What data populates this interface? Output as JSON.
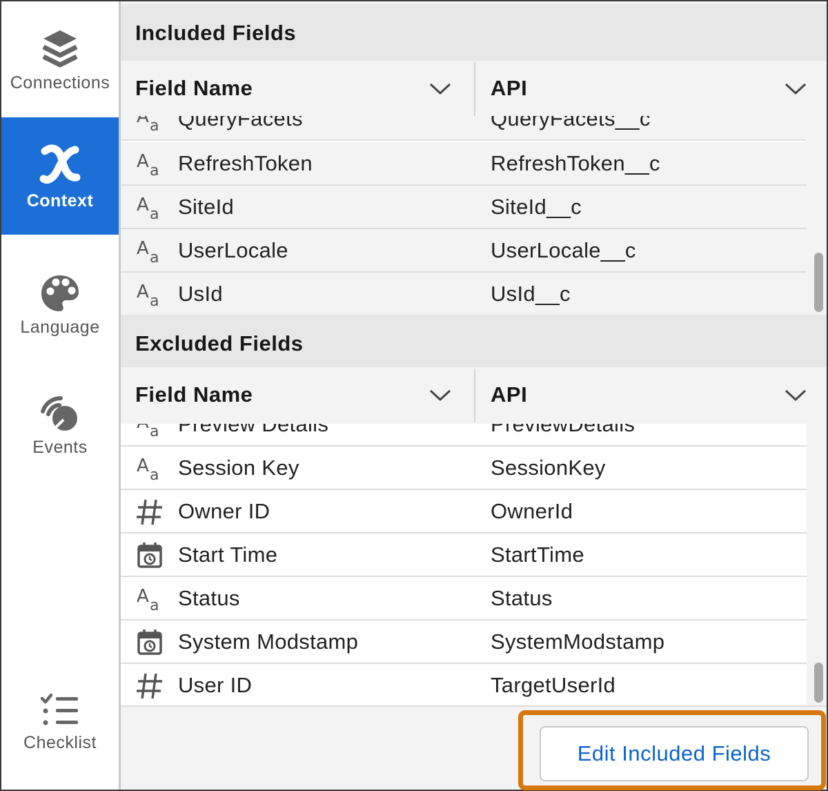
{
  "sidebar": {
    "items": [
      {
        "label": "Connections",
        "icon": "layers-icon",
        "active": false
      },
      {
        "label": "Context",
        "icon": "context-x-icon",
        "active": true
      },
      {
        "label": "Language",
        "icon": "palette-icon",
        "active": false
      },
      {
        "label": "Events",
        "icon": "signal-icon",
        "active": false
      },
      {
        "label": "Checklist",
        "icon": "checklist-icon",
        "active": false
      }
    ]
  },
  "included": {
    "title": "Included Fields",
    "columns": [
      "Field Name",
      "API"
    ],
    "rows": [
      {
        "type": "text",
        "name": "QueryFacets",
        "api": "QueryFacets__c"
      },
      {
        "type": "text",
        "name": "RefreshToken",
        "api": "RefreshToken__c"
      },
      {
        "type": "text",
        "name": "SiteId",
        "api": "SiteId__c"
      },
      {
        "type": "text",
        "name": "UserLocale",
        "api": "UserLocale__c"
      },
      {
        "type": "text",
        "name": "UsId",
        "api": "UsId__c"
      }
    ]
  },
  "excluded": {
    "title": "Excluded Fields",
    "columns": [
      "Field Name",
      "API"
    ],
    "rows": [
      {
        "type": "text",
        "name": "Preview Details",
        "api": "PreviewDetails"
      },
      {
        "type": "text",
        "name": "Session Key",
        "api": "SessionKey"
      },
      {
        "type": "number",
        "name": "Owner ID",
        "api": "OwnerId"
      },
      {
        "type": "date",
        "name": "Start Time",
        "api": "StartTime"
      },
      {
        "type": "text",
        "name": "Status",
        "api": "Status"
      },
      {
        "type": "date",
        "name": "System Modstamp",
        "api": "SystemModstamp"
      },
      {
        "type": "number",
        "name": "User ID",
        "api": "TargetUserId"
      }
    ]
  },
  "footer": {
    "edit_button_label": "Edit Included Fields"
  },
  "colors": {
    "active_nav": "#1b6fd6",
    "link_blue": "#0b63ce",
    "highlight_orange": "#d7780f"
  }
}
